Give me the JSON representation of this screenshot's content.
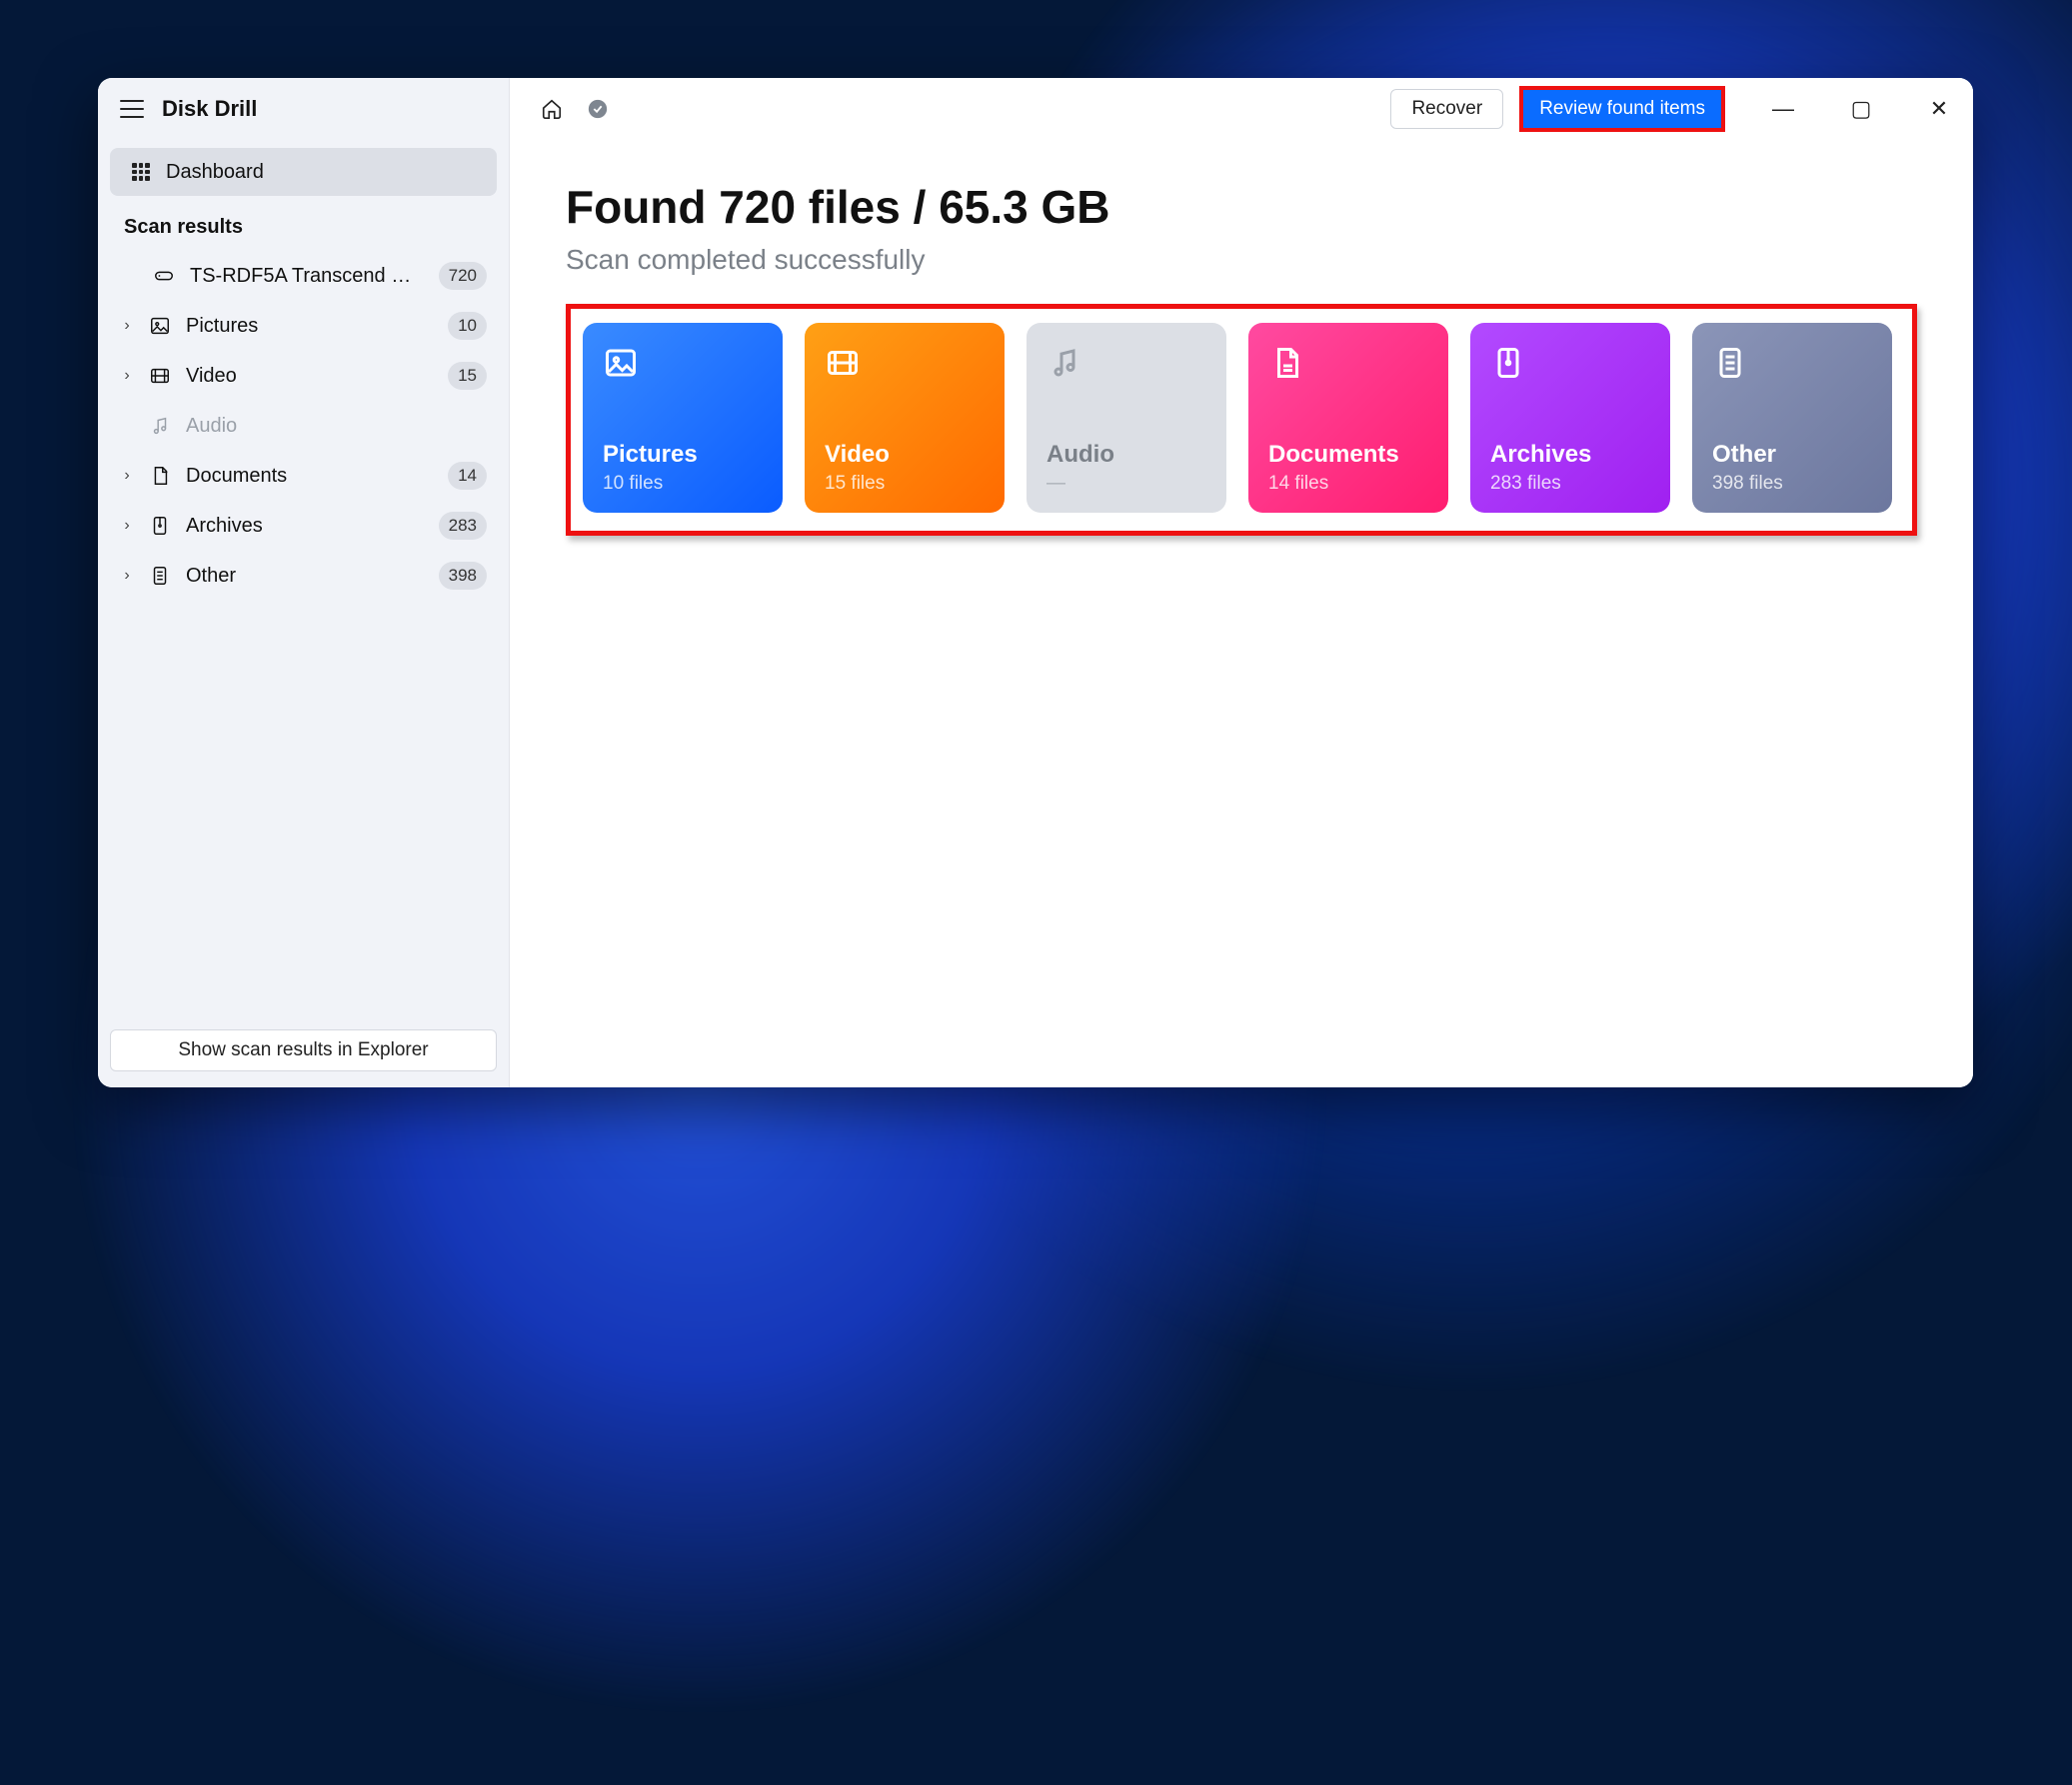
{
  "app": {
    "title": "Disk Drill"
  },
  "sidebar": {
    "dashboard_label": "Dashboard",
    "section_label": "Scan results",
    "device": {
      "label": "TS-RDF5A Transcend US...",
      "count": "720"
    },
    "items": [
      {
        "label": "Pictures",
        "count": "10"
      },
      {
        "label": "Video",
        "count": "15"
      },
      {
        "label": "Audio",
        "count": ""
      },
      {
        "label": "Documents",
        "count": "14"
      },
      {
        "label": "Archives",
        "count": "283"
      },
      {
        "label": "Other",
        "count": "398"
      }
    ],
    "footer_button": "Show scan results in Explorer"
  },
  "topbar": {
    "recover": "Recover",
    "review": "Review found items"
  },
  "hero": {
    "title": "Found 720 files / 65.3 GB",
    "subtitle": "Scan completed successfully"
  },
  "cards": {
    "pictures": {
      "title": "Pictures",
      "sub": "10 files"
    },
    "video": {
      "title": "Video",
      "sub": "15 files"
    },
    "audio": {
      "title": "Audio",
      "sub": "—"
    },
    "documents": {
      "title": "Documents",
      "sub": "14 files"
    },
    "archives": {
      "title": "Archives",
      "sub": "283 files"
    },
    "other": {
      "title": "Other",
      "sub": "398 files"
    }
  }
}
